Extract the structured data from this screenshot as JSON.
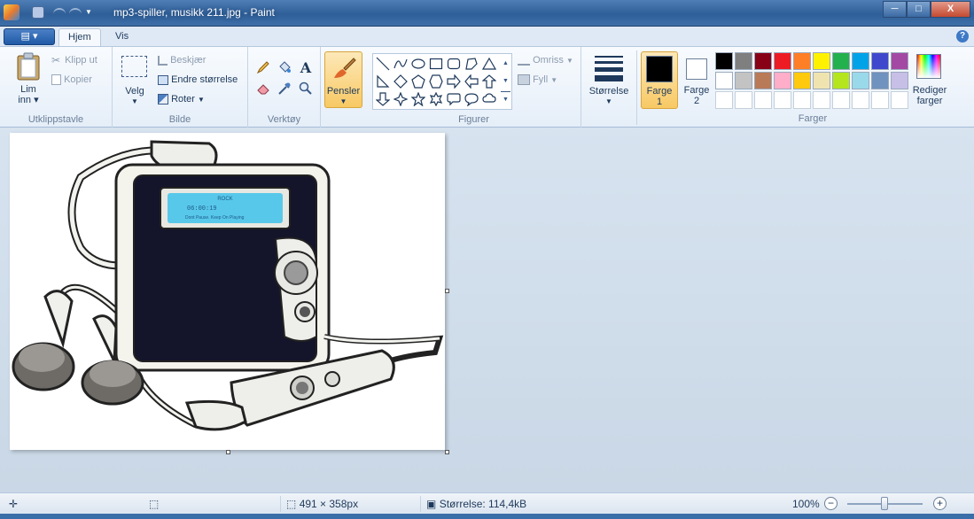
{
  "window": {
    "title": "mp3-spiller, musikk 211.jpg - Paint",
    "minimize": "─",
    "maximize": "□",
    "close": "X"
  },
  "tabs": {
    "file": "▤ ▾",
    "home": "Hjem",
    "view": "Vis",
    "help": "?"
  },
  "clipboard": {
    "paste": "Lim",
    "paste2": "inn",
    "cut": "Klipp ut",
    "copy": "Kopier",
    "label": "Utklippstavle"
  },
  "image": {
    "select": "Velg",
    "crop": "Beskjær",
    "resize": "Endre størrelse",
    "rotate": "Roter",
    "label": "Bilde"
  },
  "tools": {
    "label": "Verktøy"
  },
  "brushes": {
    "label": "Pensler"
  },
  "shapes": {
    "outline": "Omriss",
    "fill": "Fyll",
    "label": "Figurer"
  },
  "size": {
    "label": "Størrelse"
  },
  "colors": {
    "color1": "Farge",
    "color1_num": "1",
    "color2": "Farge",
    "color2_num": "2",
    "edit": "Rediger",
    "edit2": "farger",
    "label": "Farger",
    "color1_value": "#000000",
    "color2_value": "#ffffff",
    "palette": [
      "#000000",
      "#7f7f7f",
      "#880015",
      "#ed1c24",
      "#ff7f27",
      "#fff200",
      "#22b14c",
      "#00a2e8",
      "#3f48cc",
      "#a349a4",
      "#ffffff",
      "#c3c3c3",
      "#b97a57",
      "#ffaec9",
      "#ffc90e",
      "#efe4b0",
      "#b5e61d",
      "#99d9ea",
      "#7092be",
      "#c8bfe7",
      "#ffffff",
      "#ffffff",
      "#ffffff",
      "#ffffff",
      "#ffffff",
      "#ffffff",
      "#ffffff",
      "#ffffff",
      "#ffffff",
      "#ffffff"
    ]
  },
  "status": {
    "dimensions": "491 × 358px",
    "filesize": "Størrelse: 114,4kB",
    "zoom": "100%"
  },
  "lcd": {
    "line1": "ROCK",
    "line2": "06:00:19",
    "line3": "Dont Pause. Keep On Playing"
  }
}
